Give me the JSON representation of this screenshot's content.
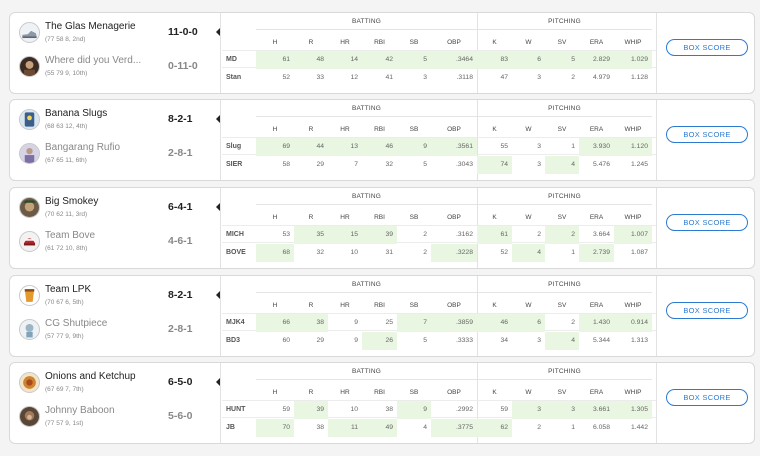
{
  "labels": {
    "batting": "BATTING",
    "pitching": "PITCHING",
    "box_score": "BOX SCORE"
  },
  "columns": {
    "batting": [
      "H",
      "R",
      "HR",
      "RBI",
      "SB",
      "OBP"
    ],
    "pitching": [
      "K",
      "W",
      "SV",
      "ERA",
      "WHIP"
    ]
  },
  "colors": {
    "highlight": "#e9f6e1",
    "accent": "#2c7bd0"
  },
  "matchups": [
    {
      "team1": {
        "name": "The Glas Menagerie",
        "sub": "(77 58 8, 2nd)",
        "record": "11-0-0",
        "winner": true,
        "icon": "shoe-icon"
      },
      "team2": {
        "name": "Where did you Verd...",
        "sub": "(55 79 9, 10th)",
        "record": "0-11-0",
        "winner": false,
        "icon": "portrait-icon"
      },
      "rows": [
        {
          "abbr": "MD",
          "values": [
            "61",
            "48",
            "14",
            "42",
            "5",
            ".3464",
            "83",
            "6",
            "5",
            "2.829",
            "1.029"
          ],
          "hi": [
            true,
            true,
            true,
            true,
            true,
            true,
            true,
            true,
            true,
            true,
            true
          ]
        },
        {
          "abbr": "Stan",
          "values": [
            "52",
            "33",
            "12",
            "41",
            "3",
            ".3118",
            "47",
            "3",
            "2",
            "4.979",
            "1.128"
          ],
          "hi": [
            false,
            false,
            false,
            false,
            false,
            false,
            false,
            false,
            false,
            false,
            false
          ]
        }
      ]
    },
    {
      "team1": {
        "name": "Banana Slugs",
        "sub": "(68 63 12, 4th)",
        "record": "8-2-1",
        "winner": true,
        "icon": "slug-icon"
      },
      "team2": {
        "name": "Bangarang Rufio",
        "sub": "(67 65 11, 6th)",
        "record": "2-8-1",
        "winner": false,
        "icon": "player-icon"
      },
      "rows": [
        {
          "abbr": "Slug",
          "values": [
            "69",
            "44",
            "13",
            "46",
            "9",
            ".3561",
            "55",
            "3",
            "1",
            "3.930",
            "1.120"
          ],
          "hi": [
            true,
            true,
            true,
            true,
            true,
            true,
            false,
            false,
            false,
            true,
            true
          ]
        },
        {
          "abbr": "SIER",
          "values": [
            "58",
            "29",
            "7",
            "32",
            "5",
            ".3043",
            "74",
            "3",
            "4",
            "5.476",
            "1.245"
          ],
          "hi": [
            false,
            false,
            false,
            false,
            false,
            false,
            true,
            false,
            true,
            false,
            false
          ]
        }
      ]
    },
    {
      "team1": {
        "name": "Big Smokey",
        "sub": "(70 62 11, 3rd)",
        "record": "6-4-1",
        "winner": true,
        "icon": "smokey-icon"
      },
      "team2": {
        "name": "Team Bove",
        "sub": "(61 72 10, 8th)",
        "record": "4-6-1",
        "winner": false,
        "icon": "cap-icon"
      },
      "rows": [
        {
          "abbr": "MICH",
          "values": [
            "53",
            "35",
            "15",
            "39",
            "2",
            ".3162",
            "61",
            "2",
            "2",
            "3.664",
            "1.007"
          ],
          "hi": [
            false,
            true,
            true,
            true,
            false,
            false,
            true,
            false,
            true,
            false,
            true
          ]
        },
        {
          "abbr": "BOVE",
          "values": [
            "68",
            "32",
            "10",
            "31",
            "2",
            ".3228",
            "52",
            "4",
            "1",
            "2.739",
            "1.087"
          ],
          "hi": [
            true,
            false,
            false,
            false,
            false,
            true,
            false,
            true,
            false,
            true,
            false
          ]
        }
      ]
    },
    {
      "team1": {
        "name": "Team LPK",
        "sub": "(70 67 6, 5th)",
        "record": "8-2-1",
        "winner": true,
        "icon": "cup-icon"
      },
      "team2": {
        "name": "CG Shutpiece",
        "sub": "(57 77 9, 9th)",
        "record": "2-8-1",
        "winner": false,
        "icon": "mascot-icon"
      },
      "rows": [
        {
          "abbr": "MJK4",
          "values": [
            "66",
            "38",
            "9",
            "25",
            "7",
            ".3859",
            "46",
            "6",
            "2",
            "1.430",
            "0.914"
          ],
          "hi": [
            true,
            true,
            false,
            false,
            true,
            true,
            true,
            true,
            false,
            true,
            true
          ]
        },
        {
          "abbr": "BD3",
          "values": [
            "60",
            "29",
            "9",
            "26",
            "5",
            ".3333",
            "34",
            "3",
            "4",
            "5.344",
            "1.313"
          ],
          "hi": [
            false,
            false,
            false,
            true,
            false,
            false,
            false,
            false,
            true,
            false,
            false
          ]
        }
      ]
    },
    {
      "team1": {
        "name": "Onions and Ketchup",
        "sub": "(67 69 7, 7th)",
        "record": "6-5-0",
        "winner": true,
        "icon": "food-icon"
      },
      "team2": {
        "name": "Johnny Baboon",
        "sub": "(77 57 9, 1st)",
        "record": "5-6-0",
        "winner": false,
        "icon": "baboon-icon"
      },
      "rows": [
        {
          "abbr": "HUNT",
          "values": [
            "59",
            "39",
            "10",
            "38",
            "9",
            ".2992",
            "59",
            "3",
            "3",
            "3.661",
            "1.305"
          ],
          "hi": [
            false,
            true,
            false,
            false,
            true,
            false,
            false,
            true,
            true,
            true,
            true
          ]
        },
        {
          "abbr": "JB",
          "values": [
            "70",
            "38",
            "11",
            "49",
            "4",
            ".3775",
            "62",
            "2",
            "1",
            "6.058",
            "1.442"
          ],
          "hi": [
            true,
            false,
            true,
            true,
            false,
            true,
            true,
            false,
            false,
            false,
            false
          ]
        }
      ]
    }
  ]
}
